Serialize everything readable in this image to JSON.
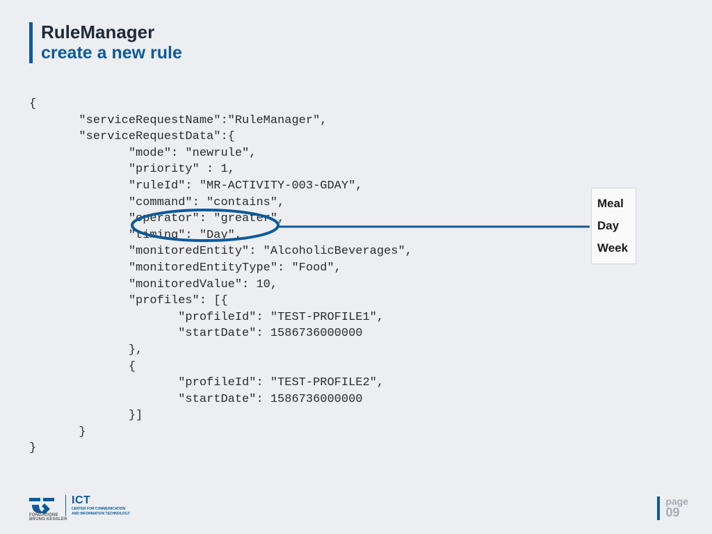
{
  "header": {
    "title": "RuleManager",
    "subtitle": "create a new rule"
  },
  "code": "{\n       \"serviceRequestName\":\"RuleManager\",\n       \"serviceRequestData\":{\n              \"mode\": \"newrule\",\n              \"priority\" : 1,\n              \"ruleId\": \"MR-ACTIVITY-003-GDAY\",\n              \"command\": \"contains\",\n              \"operator\": \"greater\",\n              \"timing\": \"Day\",\n              \"monitoredEntity\": \"AlcoholicBeverages\",\n              \"monitoredEntityType\": \"Food\",\n              \"monitoredValue\": 10,\n              \"profiles\": [{\n                     \"profileId\": \"TEST-PROFILE1\",\n                     \"startDate\": 1586736000000\n              },\n              {\n                     \"profileId\": \"TEST-PROFILE2\",\n                     \"startDate\": 1586736000000\n              }]\n       }\n}",
  "callout": {
    "opt1": "Meal",
    "opt2": "Day",
    "opt3": "Week"
  },
  "logo": {
    "ict": "ICT",
    "line1": "CENTER FOR COMMUNICATION",
    "line2": "AND INFORMATION TECHNOLOGY",
    "fond1": "FONDAZIONE",
    "fond2": "BRUNO KESSLER"
  },
  "page": {
    "label": "page",
    "number": "09"
  }
}
